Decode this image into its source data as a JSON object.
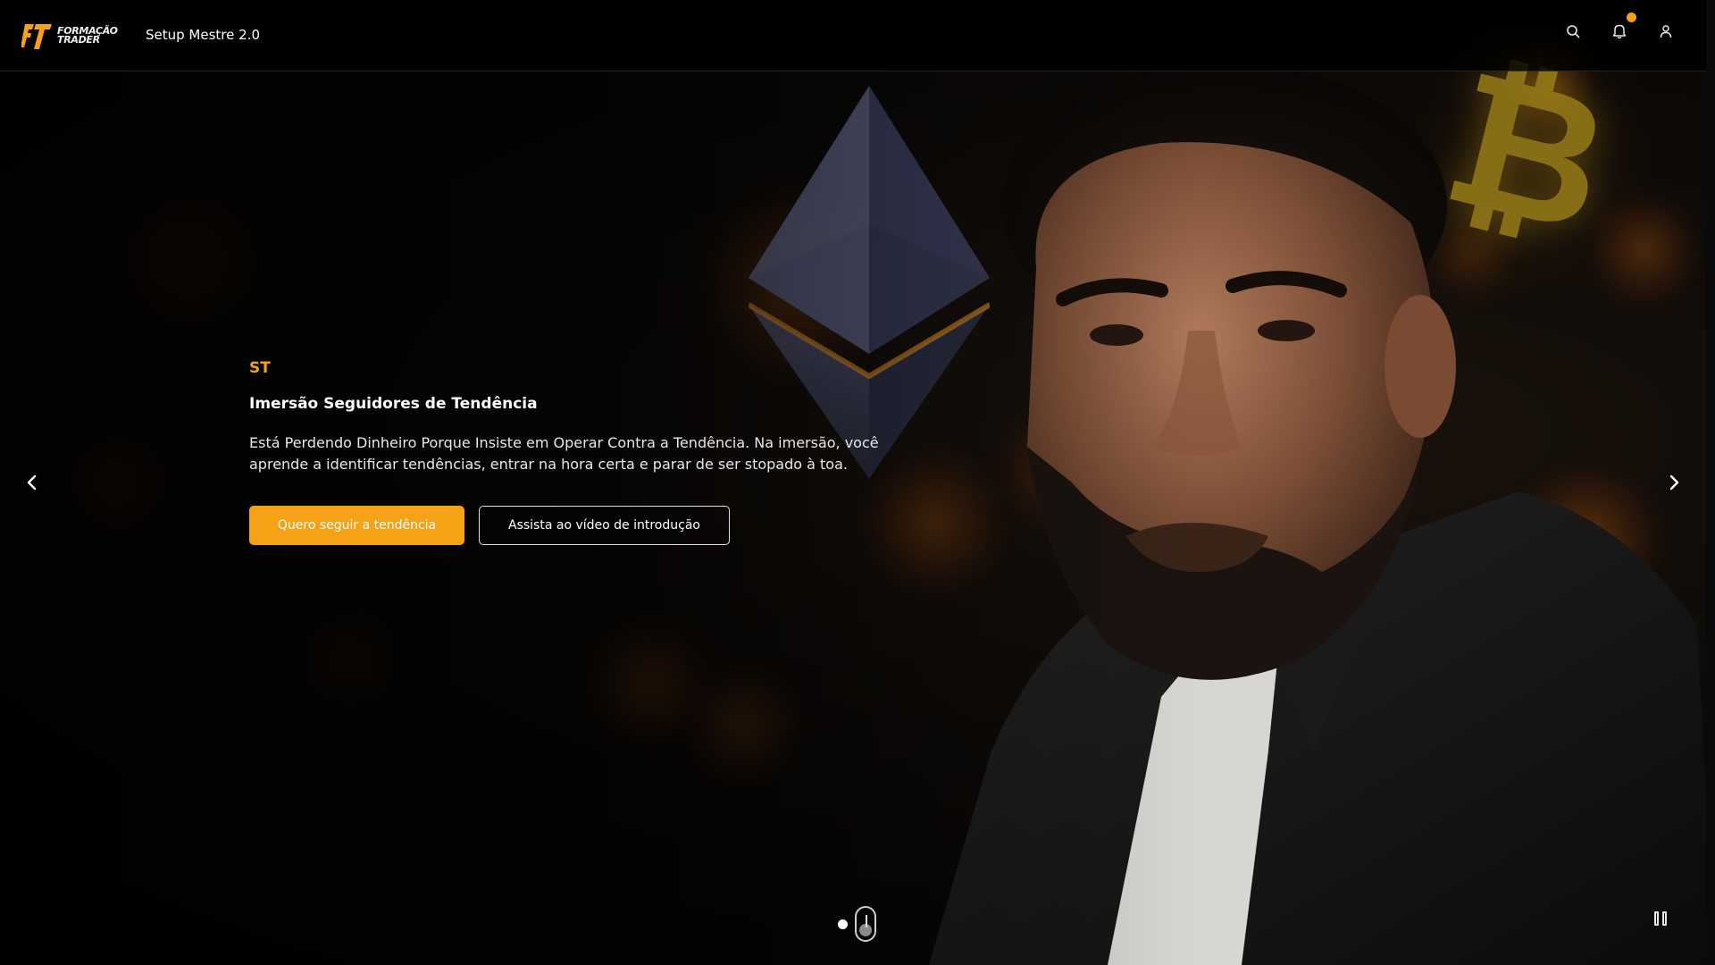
{
  "header": {
    "brand_line1": "FORMAÇÃO",
    "brand_line2": "TRADER",
    "app_title": "Setup Mestre 2.0",
    "icons": [
      "search-icon",
      "bell-icon",
      "user-icon"
    ],
    "notification_dot_color": "#f5a216"
  },
  "hero": {
    "tag": "ST",
    "title": "Imersão Seguidores de Tendência",
    "description": "Está Perdendo Dinheiro Porque Insiste em Operar Contra a Tendência. Na imersão, você aprende a identificar tendências, entrar na hora certa e parar de ser stopado à toa.",
    "primary_cta": "Quero seguir a tendência",
    "secondary_cta": "Assista ao vídeo de introdução"
  },
  "carousel": {
    "slide_count": 2,
    "active_slide": 2,
    "prev_icon": "chevron-left-icon",
    "next_icon": "chevron-right-icon",
    "pause_icon": "pause-icon"
  },
  "colors": {
    "accent": "#f5a216",
    "background": "#000000",
    "text": "#ffffff"
  }
}
